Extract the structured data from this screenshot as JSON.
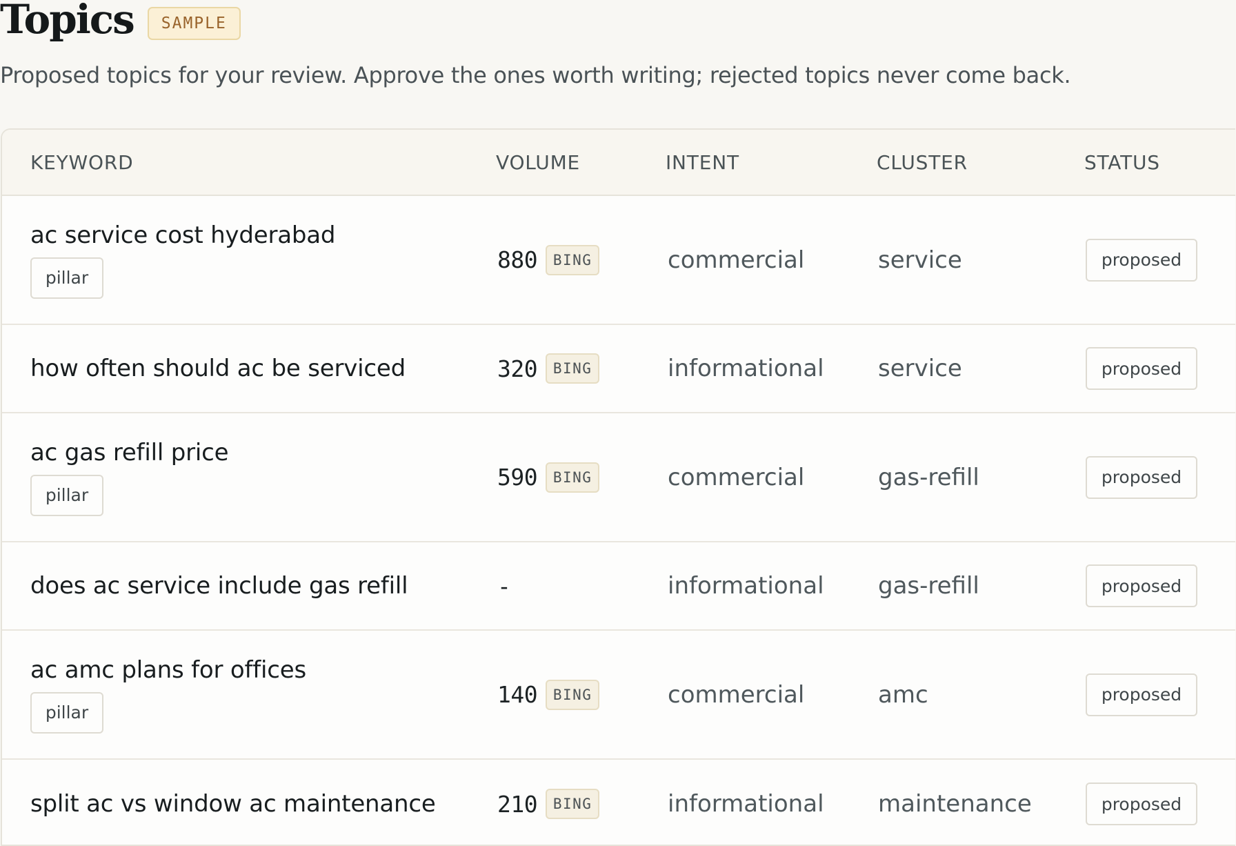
{
  "header": {
    "title": "Topics",
    "badge": "SAMPLE",
    "subtitle": "Proposed topics for your review. Approve the ones worth writing; rejected topics never come back."
  },
  "table": {
    "columns": {
      "keyword": "KEYWORD",
      "volume": "VOLUME",
      "intent": "INTENT",
      "cluster": "CLUSTER",
      "status": "STATUS"
    },
    "rows": [
      {
        "keyword": "ac service cost hyderabad",
        "tag": "pillar",
        "volume": "880",
        "source": "BING",
        "intent": "commercial",
        "cluster": "service",
        "status": "proposed"
      },
      {
        "keyword": "how often should ac be serviced",
        "tag": "",
        "volume": "320",
        "source": "BING",
        "intent": "informational",
        "cluster": "service",
        "status": "proposed"
      },
      {
        "keyword": "ac gas refill price",
        "tag": "pillar",
        "volume": "590",
        "source": "BING",
        "intent": "commercial",
        "cluster": "gas-refill",
        "status": "proposed"
      },
      {
        "keyword": "does ac service include gas refill",
        "tag": "",
        "volume": "-",
        "source": "",
        "intent": "informational",
        "cluster": "gas-refill",
        "status": "proposed"
      },
      {
        "keyword": "ac amc plans for offices",
        "tag": "pillar",
        "volume": "140",
        "source": "BING",
        "intent": "commercial",
        "cluster": "amc",
        "status": "proposed"
      },
      {
        "keyword": "split ac vs window ac maintenance",
        "tag": "",
        "volume": "210",
        "source": "BING",
        "intent": "informational",
        "cluster": "maintenance",
        "status": "proposed"
      }
    ]
  }
}
